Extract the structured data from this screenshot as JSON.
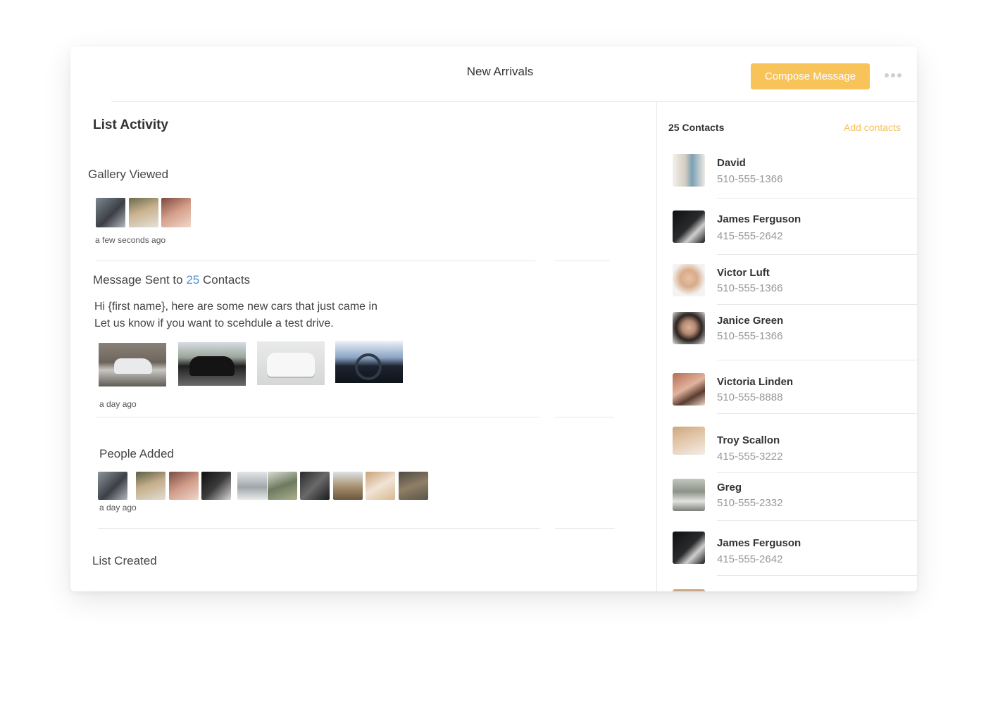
{
  "header": {
    "title": "New Arrivals",
    "compose_label": "Compose Message",
    "more_icon": "more-horizontal-icon",
    "accent_color": "#f8c45a"
  },
  "activity": {
    "heading": "List Activity",
    "gallery": {
      "title": "Gallery Viewed",
      "timestamp": "a few seconds ago"
    },
    "message": {
      "title_prefix": "Message Sent to",
      "count": "25",
      "title_suffix": "Contacts",
      "line1": "Hi {first name}, here are some new cars that just came in",
      "line2": "Let us know if you want to scehdule a test drive.",
      "timestamp": "a day ago"
    },
    "people": {
      "title": "People Added",
      "timestamp": "a day ago"
    },
    "created": {
      "title": "List Created"
    }
  },
  "contacts": {
    "count_label": "25 Contacts",
    "add_label": "Add contacts",
    "items": [
      {
        "name": "David",
        "phone": "510-555-1366"
      },
      {
        "name": "James Ferguson",
        "phone": "415-555-2642"
      },
      {
        "name": "Victor Luft",
        "phone": "510-555-1366"
      },
      {
        "name": "Janice Green",
        "phone": "510-555-1366"
      },
      {
        "name": "Victoria Linden",
        "phone": "510-555-8888"
      },
      {
        "name": "Troy Scallon",
        "phone": "415-555-3222"
      },
      {
        "name": "Greg",
        "phone": "510-555-2332"
      },
      {
        "name": "James Ferguson",
        "phone": "415-555-2642"
      }
    ]
  }
}
